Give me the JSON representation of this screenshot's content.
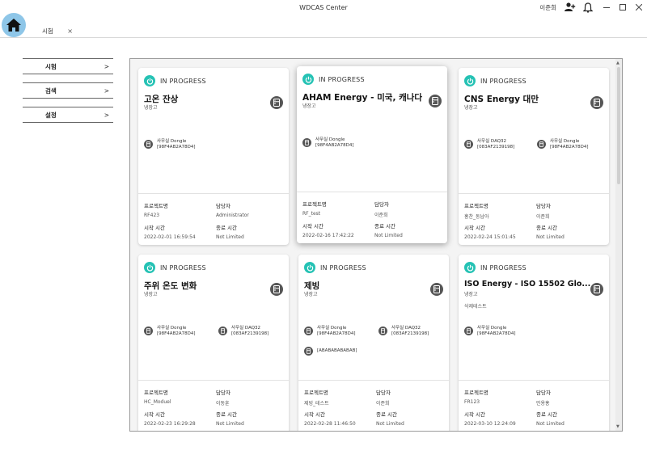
{
  "app": {
    "title": "WDCAS Center",
    "user": "이준희"
  },
  "tab": {
    "label": "시험",
    "close": "×"
  },
  "sidebar": {
    "items": [
      {
        "label": "시험",
        "chevron": ">"
      },
      {
        "label": "검색",
        "chevron": ">"
      },
      {
        "label": "설정",
        "chevron": ">"
      }
    ]
  },
  "labels": {
    "project": "프로젝트명",
    "manager": "담당자",
    "start": "시작 시간",
    "end": "종료 시간"
  },
  "cards": [
    {
      "status": "IN PROGRESS",
      "title": "고온 잔상",
      "subtitle": "냉장고",
      "note": "",
      "devices": [
        {
          "name": "사무실 Dongle",
          "id": "[98F4AB2A78D4]"
        }
      ],
      "project": "RF423",
      "manager": "Administrator",
      "start": "2022-02-01 16:59:54",
      "end": "Not Limited"
    },
    {
      "status": "IN PROGRESS",
      "title": "AHAM Energy - 미국, 캐나다",
      "subtitle": "냉장고",
      "note": "",
      "devices": [
        {
          "name": "사무실 Dongle",
          "id": "[98F4AB2A78D4]"
        }
      ],
      "project": "RF_test",
      "manager": "이준희",
      "start": "2022-02-16 17:42:22",
      "end": "Not Limited"
    },
    {
      "status": "IN PROGRESS",
      "title": "CNS Energy  대만",
      "subtitle": "냉장고",
      "note": "",
      "devices": [
        {
          "name": "사무실 DAQ32",
          "id": "[083AF2139198]"
        },
        {
          "name": "사무실 Dongle",
          "id": "[98F4AB2A78D4]"
        }
      ],
      "project": "홍찬_동남아",
      "manager": "이준희",
      "start": "2022-02-24 15:01:45",
      "end": "Not Limited"
    },
    {
      "status": "IN PROGRESS",
      "title": "주위 온도 변화",
      "subtitle": "냉장고",
      "note": "",
      "devices": [
        {
          "name": "사무실 Dongle",
          "id": "[98F4AB2A78D4]"
        },
        {
          "name": "사무실 DAQ32",
          "id": "[083AF2139198]"
        }
      ],
      "project": "HC_Moduel",
      "manager": "이동훈",
      "start": "2022-02-23 16:29:28",
      "end": "Not Limited"
    },
    {
      "status": "IN PROGRESS",
      "title": "제빙",
      "subtitle": "냉장고",
      "note": "",
      "devices": [
        {
          "name": "사무실 Dongle",
          "id": "[98F4AB2A78D4]"
        },
        {
          "name": "사무실 DAQ32",
          "id": "[083AF2139198]"
        },
        {
          "name": "",
          "id": "[ABABABABABAB]"
        }
      ],
      "project": "제빙_테스트",
      "manager": "이준희",
      "start": "2022-02-28 11:46:50",
      "end": "Not Limited"
    },
    {
      "status": "IN PROGRESS",
      "title": "ISO Energy - ISO 15502  Glo...",
      "subtitle": "냉장고",
      "note": "삭제테스트",
      "devices": [
        {
          "name": "사무실 Dongle",
          "id": "[98F4AB2A78D4]"
        }
      ],
      "project": "FR123",
      "manager": "민용홍",
      "start": "2022-03-10 12:24:09",
      "end": "Not Limited"
    }
  ],
  "colors": {
    "status": "#25c2b4",
    "icon_bg": "#565656",
    "home_bg": "#8ec6e8"
  },
  "icons": {
    "home": "home-icon",
    "status": "power-icon",
    "device": "fridge-icon",
    "add_user": "add-user-icon",
    "bell": "bell-icon"
  }
}
